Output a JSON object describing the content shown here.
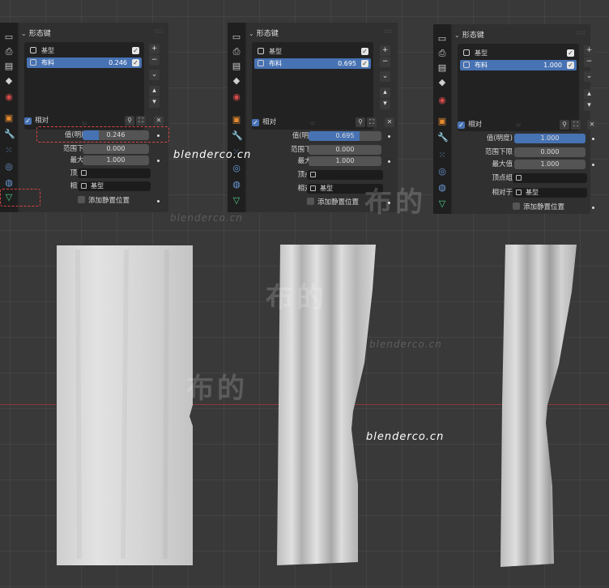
{
  "panels": [
    {
      "header": "形态键",
      "keys": [
        {
          "name": "基型",
          "value": "",
          "selected": false
        },
        {
          "name": "布料",
          "value": "0.246",
          "selected": true
        }
      ],
      "relative_label": "相对",
      "props": {
        "value_label": "值(明度)",
        "value": "0.246",
        "value_fraction": 0.246,
        "range_min_label": "范围下限",
        "range_min": "0.000",
        "max_label": "最大值",
        "max": "1.000",
        "vgroup_label": "顶点组",
        "vgroup": "",
        "relative_to_label": "相对于",
        "relative_to": "基型",
        "rest_label": "添加静置位置"
      }
    },
    {
      "header": "形态键",
      "keys": [
        {
          "name": "基型",
          "value": "",
          "selected": false
        },
        {
          "name": "布料",
          "value": "0.695",
          "selected": true
        }
      ],
      "relative_label": "相对",
      "props": {
        "value_label": "值(明度)",
        "value": "0.695",
        "value_fraction": 0.695,
        "range_min_label": "范围下限",
        "range_min": "0.000",
        "max_label": "最大值",
        "max": "1.000",
        "vgroup_label": "顶点组",
        "vgroup": "",
        "relative_to_label": "相对于",
        "relative_to": "基型",
        "rest_label": "添加静置位置"
      }
    },
    {
      "header": "形态键",
      "keys": [
        {
          "name": "基型",
          "value": "",
          "selected": false
        },
        {
          "name": "布料",
          "value": "1.000",
          "selected": true
        }
      ],
      "relative_label": "相对",
      "props": {
        "value_label": "值(明度)",
        "value": "1.000",
        "value_fraction": 1.0,
        "range_min_label": "范围下限",
        "range_min": "0.000",
        "max_label": "最大值",
        "max": "1.000",
        "vgroup_label": "顶点组",
        "vgroup": "",
        "relative_to_label": "相对于",
        "relative_to": "基型",
        "rest_label": "添加静置位置"
      }
    }
  ],
  "watermarks": {
    "text1": "blenderco.cn",
    "text2": "blenderco.cn",
    "text3": "blenderco.cn",
    "text4": "blenderco.cn",
    "big1": "布的",
    "big2": "布的",
    "big3": "布的"
  },
  "colors": {
    "accent": "#4772b3",
    "background": "#393939",
    "highlight_box": "#d94444"
  }
}
